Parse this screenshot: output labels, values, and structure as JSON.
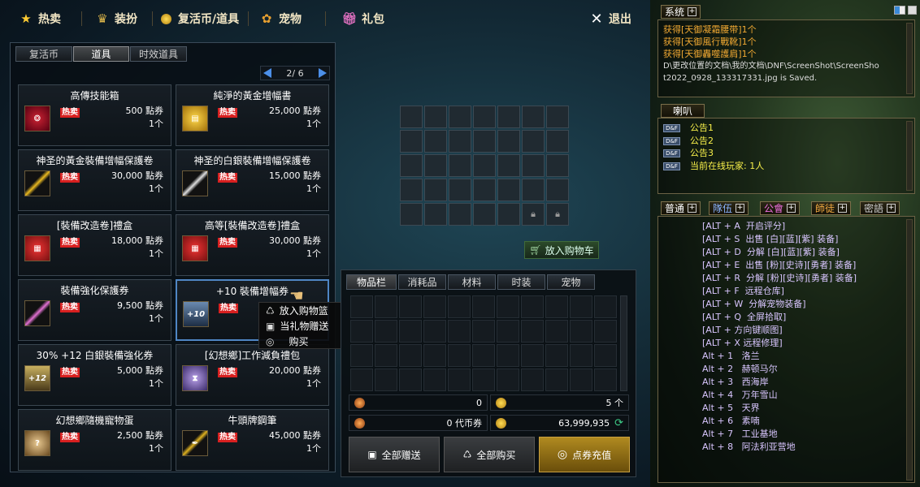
{
  "nav": {
    "hot": "热卖",
    "outfit": "装扮",
    "revive": "复活币/道具",
    "pet": "宠物",
    "gift": "礼包",
    "exit": "退出"
  },
  "shop": {
    "tabs": [
      "复活币",
      "道具",
      "时效道具"
    ],
    "page": "2/ 6",
    "hot_label": "热卖",
    "items": [
      {
        "name": "高傳技能箱",
        "price": "500 點券",
        "qty": "1个"
      },
      {
        "name": "純淨的黃金增幅書",
        "price": "25,000 點券",
        "qty": "1个"
      },
      {
        "name": "神圣的黃金裝備增幅保護卷",
        "price": "30,000 點券",
        "qty": "1个"
      },
      {
        "name": "神圣的白銀裝備增幅保護卷",
        "price": "15,000 點券",
        "qty": "1个"
      },
      {
        "name": "[裝備改造卷]禮盒",
        "price": "18,000 點券",
        "qty": "1个"
      },
      {
        "name": "高等[裝備改造卷]禮盒",
        "price": "30,000 點券",
        "qty": "1个"
      },
      {
        "name": "裝備強化保護券",
        "price": "9,500 點券",
        "qty": "1个"
      },
      {
        "name": "+10 裝備增幅券",
        "price": "",
        "qty": "",
        "icon_text": "+10"
      },
      {
        "name": "30% +12 白銀裝備強化券",
        "price": "5,000 點券",
        "qty": "1个",
        "icon_text": "+12"
      },
      {
        "name": "[幻想鄉]工作減負禮包",
        "price": "20,000 點券",
        "qty": "1个"
      },
      {
        "name": "幻想鄉隨機寵物蛋",
        "price": "2,500 點券",
        "qty": "1个"
      },
      {
        "name": "牛頭牌鋼筆",
        "price": "45,000 點券",
        "qty": "1个"
      }
    ],
    "context_menu": [
      "放入购物篮",
      "当礼物赠送",
      "购买"
    ]
  },
  "cart": {
    "button": "放入购物车"
  },
  "inventory": {
    "tabs": [
      "物品栏",
      "消耗品",
      "材料",
      "时装",
      "宠物"
    ],
    "stat1": "0",
    "stat2": "5 个",
    "stat3": "0 代币券",
    "stat4": "63,999,935",
    "btn_gift_all": "全部赠送",
    "btn_buy_all": "全部购买",
    "btn_recharge": "点券充值"
  },
  "system": {
    "tab": "系统",
    "messages": [
      "获得[天御凝霜腰带]1个",
      "获得[天御風行戰靴]1个",
      "获得[天御轟噬護肩]1个",
      "D\\更改位置的文档\\我的文档\\DNF\\ScreenShot\\ScreenSho",
      "t2022_0928_133317331.jpg is Saved."
    ]
  },
  "horn": {
    "tab": "喇叭",
    "badge": "D&F",
    "lines": [
      "公告1",
      "公告2",
      "公告3",
      "当前在线玩家: 1人"
    ]
  },
  "chat": {
    "tabs": [
      "普通",
      "隊伍",
      "公會",
      "師徒",
      "密語"
    ],
    "lines": [
      "[ALT + A  开启评分]",
      "[ALT + S  出售 [白][蓝][紫] 装备]",
      "[ALT + D  分解 [白][蓝][紫] 装备]",
      "[ALT + E  出售 [粉][史诗][勇者] 装备]",
      "[ALT + R  分解 [粉][史诗][勇者] 装备]",
      "[ALT + F  远程仓库]",
      "[ALT + W  分解宠物装备]",
      "[ALT + Q  全屏拾取]",
      "[ALT + 方向键顺图]",
      "[ALT + X 远程修理]",
      "Alt + 1   洛兰",
      "Alt + 2   赫顿马尔",
      "Alt + 3   西海岸",
      "Alt + 4   万年雪山",
      "Alt + 5   天界",
      "Alt + 6   素喃",
      "Alt + 7   工业基地",
      "Alt + 8   阿法利亚营地"
    ]
  }
}
